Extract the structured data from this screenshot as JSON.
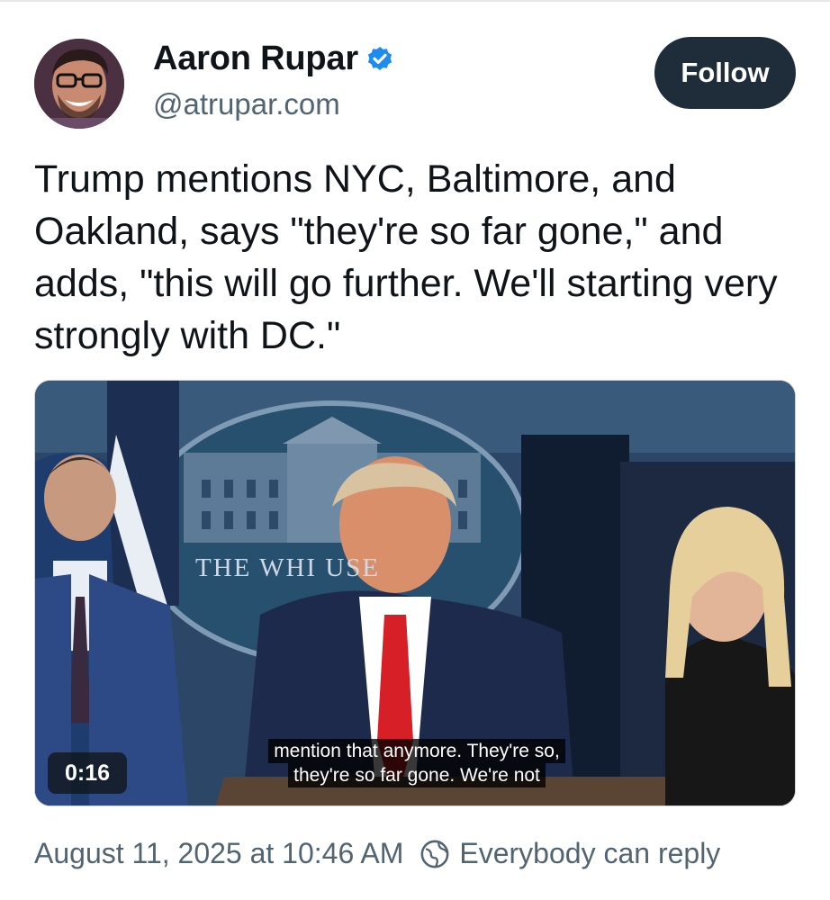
{
  "author": {
    "name": "Aaron Rupar",
    "handle": "@atrupar.com",
    "verified": true,
    "avatar_icon": "user-avatar"
  },
  "follow_button": {
    "label": "Follow"
  },
  "post": {
    "text": "Trump mentions NYC, Baltimore, and Oakland, says \"they're so far gone,\" and adds, \"this will go further. We'll starting very strongly with DC.\""
  },
  "video": {
    "duration": "0:16",
    "caption_line1": "mention that anymore. They're so,",
    "caption_line2": "they're so far gone. We're not",
    "backdrop_text": "THE WHI    USE"
  },
  "meta": {
    "timestamp": "August 11, 2025 at 10:46 AM",
    "reply_setting": "Everybody can reply",
    "reply_icon": "globe-icon"
  },
  "colors": {
    "follow_bg": "#1f2d3a",
    "verified": "#1d8cf0",
    "muted_text": "#536471"
  }
}
